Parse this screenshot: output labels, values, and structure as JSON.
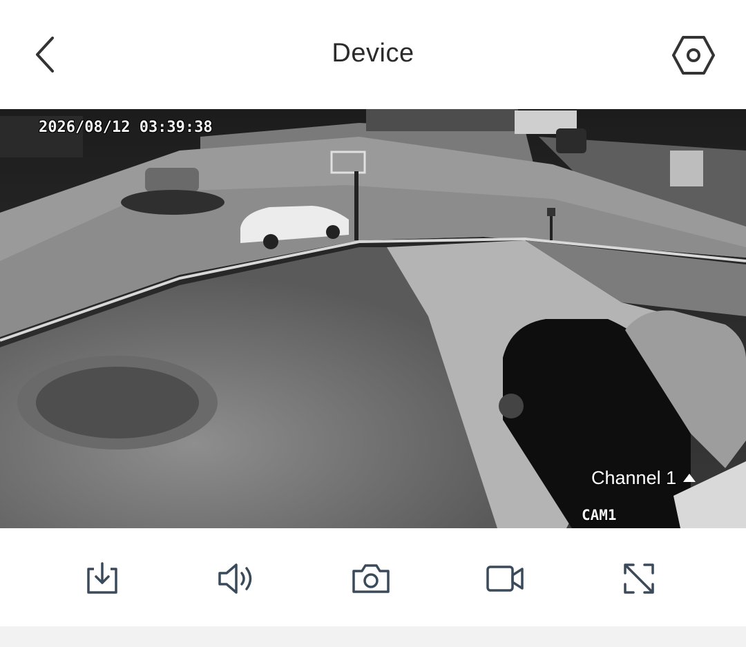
{
  "header": {
    "title": "Device",
    "back_icon": "chevron-left-icon",
    "settings_icon": "hexagon-gear-icon"
  },
  "video": {
    "timestamp": "2026/08/12 03:39:38",
    "camera_label": "CAM1",
    "channel_label": "Channel 1"
  },
  "toolbar": {
    "items": [
      {
        "icon": "download-icon"
      },
      {
        "icon": "speaker-icon"
      },
      {
        "icon": "camera-icon"
      },
      {
        "icon": "video-record-icon"
      },
      {
        "icon": "fullscreen-icon"
      }
    ]
  },
  "colors": {
    "icon": "#3a4a5a",
    "title": "#2b2b2b",
    "bottom_strip": "#f2f2f2"
  }
}
